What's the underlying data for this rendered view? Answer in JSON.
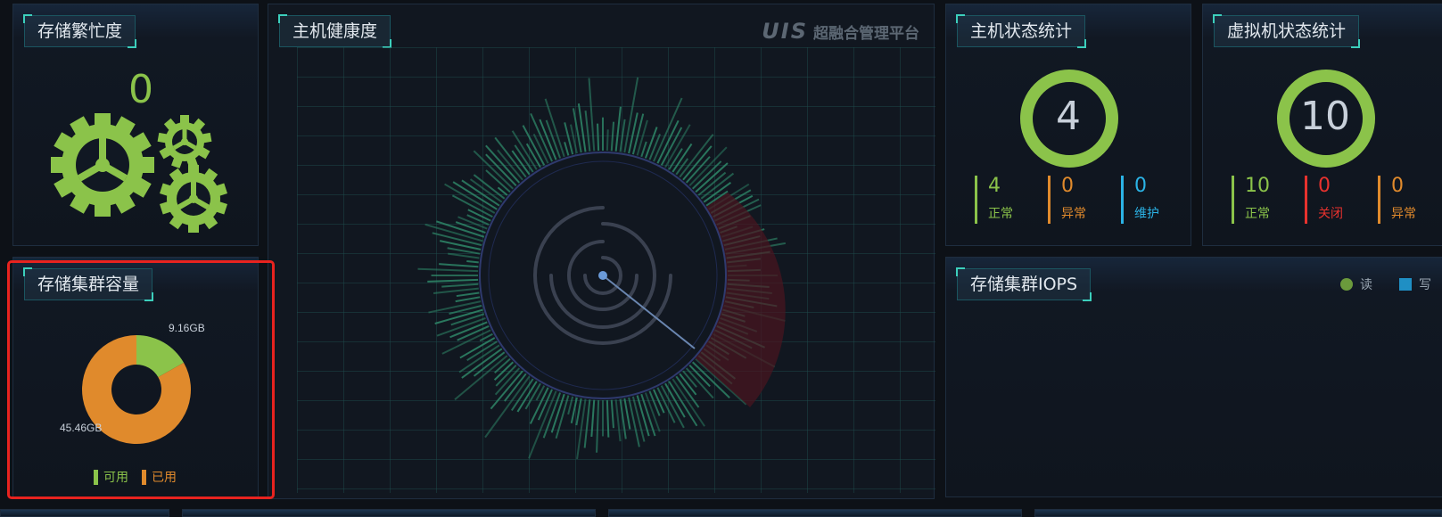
{
  "storage_busy": {
    "title": "存储繁忙度",
    "value": "0"
  },
  "host_health": {
    "title": "主机健康度",
    "brand_logo": "UIS",
    "brand_name": "超融合管理平台"
  },
  "host_status": {
    "title": "主机状态统计",
    "total": "4",
    "stats": [
      {
        "value": "4",
        "label": "正常",
        "color": "#8bc34a"
      },
      {
        "value": "0",
        "label": "异常",
        "color": "#e08a2c"
      },
      {
        "value": "0",
        "label": "维护",
        "color": "#2bb3e6"
      }
    ]
  },
  "vm_status": {
    "title": "虚拟机状态统计",
    "total": "10",
    "stats": [
      {
        "value": "10",
        "label": "正常",
        "color": "#8bc34a"
      },
      {
        "value": "0",
        "label": "关闭",
        "color": "#e8322e"
      },
      {
        "value": "0",
        "label": "异常",
        "color": "#e08a2c"
      }
    ]
  },
  "storage_capacity": {
    "title": "存储集群容量",
    "available_label": "9.16GB",
    "used_label": "45.46GB",
    "legend_available": "可用",
    "legend_used": "已用",
    "available_value": 9.16,
    "used_value": 45.46,
    "available_color": "#8bc34a",
    "used_color": "#e08a2c"
  },
  "storage_iops": {
    "title": "存储集群IOPS",
    "legend_read": "读",
    "legend_write": "写",
    "read_color": "#6b9a3c",
    "write_color": "#1f8fc4"
  },
  "colors": {
    "accent": "#3ccfbc",
    "highlight_border": "#e8231f"
  }
}
